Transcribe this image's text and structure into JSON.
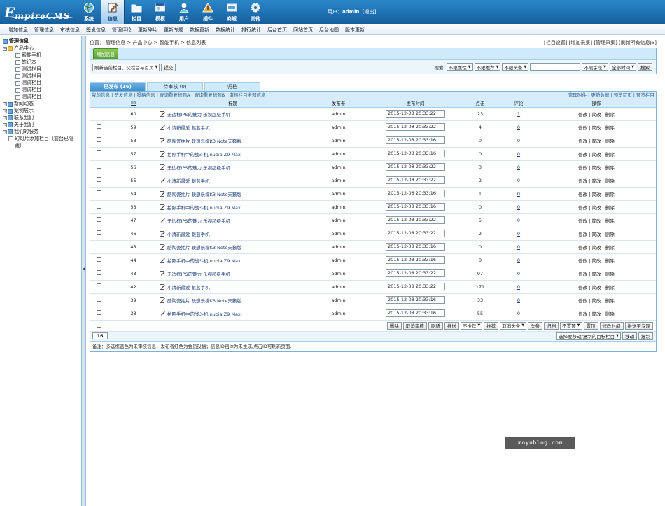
{
  "logo": {
    "e": "E",
    "rest": "mpireCMS"
  },
  "nav": [
    {
      "label": "系统",
      "icon": "globe-icon",
      "active": false
    },
    {
      "label": "信息",
      "icon": "pencil-icon",
      "active": true
    },
    {
      "label": "栏目",
      "icon": "folder-icon",
      "active": false
    },
    {
      "label": "模板",
      "icon": "window-icon",
      "active": false
    },
    {
      "label": "用户",
      "icon": "user-icon",
      "active": false
    },
    {
      "label": "插件",
      "icon": "triangle-icon",
      "active": false
    },
    {
      "label": "商城",
      "icon": "shop-icon",
      "active": false
    },
    {
      "label": "其他",
      "icon": "gear-icon",
      "active": false
    }
  ],
  "user": {
    "prefix": "用户：",
    "name": "admin",
    "logout": "[退出]"
  },
  "subnav": [
    "增加信息",
    "管理信息",
    "审核信息",
    "签发信息",
    "管理评论",
    "更新碎片",
    "更新专题",
    "数据更新",
    "数据统计",
    "排行统计",
    "后台首页",
    "网站首页",
    "后台地图",
    "版本更新"
  ],
  "tree": {
    "root": "管理信息",
    "items": [
      {
        "label": "产品中心",
        "level": 0,
        "type": "open"
      },
      {
        "label": "智能手机",
        "level": 2,
        "type": "doc"
      },
      {
        "label": "笔记本",
        "level": 2,
        "type": "doc"
      },
      {
        "label": "测试栏目",
        "level": 2,
        "type": "doc"
      },
      {
        "label": "测试栏目",
        "level": 2,
        "type": "doc"
      },
      {
        "label": "测试栏目",
        "level": 2,
        "type": "doc"
      },
      {
        "label": "测试栏目",
        "level": 2,
        "type": "doc"
      },
      {
        "label": "测试栏目",
        "level": 2,
        "type": "doc"
      },
      {
        "label": "新闻动态",
        "level": 0,
        "type": "closed"
      },
      {
        "label": "案例展示",
        "level": 0,
        "type": "closed"
      },
      {
        "label": "联系我们",
        "level": 0,
        "type": "closed"
      },
      {
        "label": "关于我们",
        "level": 0,
        "type": "closed"
      },
      {
        "label": "我们的服务",
        "level": 0,
        "type": "closed"
      },
      {
        "label": "幻灯片添加栏目（前台已隐",
        "level": 1,
        "type": "doc"
      },
      {
        "label": "藏）",
        "level": 1,
        "type": "cont"
      }
    ]
  },
  "position": {
    "text": "位置： 管理信息 > 产品中心 > 智能手机 > 信息列表",
    "right": "[栏目设置] [增加采集] [管理采集] [刷新所有信息JS]"
  },
  "toolbar": {
    "add_button": "增加信息",
    "refresh_select": "刷新当前栏目、父栏目与首页",
    "submit": "提交",
    "search_label": "搜索:",
    "filters": [
      "不限属性",
      "不限推荐",
      "不限头条"
    ],
    "field_select": "不限字段",
    "time_select": "全部时间",
    "search_button": "搜索"
  },
  "tabs": [
    {
      "label": "已发布 (16)",
      "active": true
    },
    {
      "label": "待审核 (0)",
      "active": false
    },
    {
      "label": "归档",
      "active": false
    }
  ],
  "linkrow": {
    "left": "我的信息 | 签发信息 | 投稿信息 | 查询重复标题A | 查询重复标题B | 审核栏目全部信息",
    "right": "管理附件 | 更新数据 | 预览首页 | 预览栏目"
  },
  "columns": [
    "ID",
    "标题",
    "发布者",
    "发布时间",
    "点击",
    "评论",
    "操作"
  ],
  "rows": [
    {
      "id": "60",
      "title": "无边框IPS的魅力 乐视超级手机",
      "author": "admin",
      "time": "2015-12-08 20:33:22",
      "clicks": "23",
      "comments": "1"
    },
    {
      "id": "59",
      "title": "小清新最爱 魅蓝手机",
      "author": "admin",
      "time": "2015-12-08 20:33:22",
      "clicks": "4",
      "comments": "0"
    },
    {
      "id": "58",
      "title": "酷陶瓷抽片 联想乐檬K3 Note天籁版",
      "author": "admin",
      "time": "2015-12-08 20:33:16",
      "clicks": "0",
      "comments": "0"
    },
    {
      "id": "57",
      "title": "拍照手机中的战斗机 nubia Z9 Max",
      "author": "admin",
      "time": "2015-12-08 20:33:16",
      "clicks": "0",
      "comments": "0"
    },
    {
      "id": "56",
      "title": "无边框IPS的魅力 乐视超级手机",
      "author": "admin",
      "time": "2015-12-08 20:33:22",
      "clicks": "3",
      "comments": "0"
    },
    {
      "id": "55",
      "title": "小清新最爱 魅蓝手机",
      "author": "admin",
      "time": "2015-12-08 20:33:22",
      "clicks": "2",
      "comments": "0"
    },
    {
      "id": "54",
      "title": "酷陶瓷抽片 联想乐檬K3 Note天籁版",
      "author": "admin",
      "time": "2015-12-08 20:33:16",
      "clicks": "1",
      "comments": "0"
    },
    {
      "id": "53",
      "title": "拍照手机中的战斗机 nubia Z9 Max",
      "author": "admin",
      "time": "2015-12-08 20:33:16",
      "clicks": "0",
      "comments": "0"
    },
    {
      "id": "47",
      "title": "无边框IPS的魅力 乐视超级手机",
      "author": "admin",
      "time": "2015-12-08 20:33:22",
      "clicks": "5",
      "comments": "0"
    },
    {
      "id": "46",
      "title": "小清新最爱 魅蓝手机",
      "author": "admin",
      "time": "2015-12-08 20:33:22",
      "clicks": "2",
      "comments": "0"
    },
    {
      "id": "45",
      "title": "酷陶瓷抽片 联想乐檬K3 Note天籁版",
      "author": "admin",
      "time": "2015-12-08 20:33:16",
      "clicks": "0",
      "comments": "0"
    },
    {
      "id": "44",
      "title": "拍照手机中的战斗机 nubia Z9 Max",
      "author": "admin",
      "time": "2015-12-08 20:33:16",
      "clicks": "0",
      "comments": "0"
    },
    {
      "id": "43",
      "title": "无边框IPS的魅力 乐视超级手机",
      "author": "admin",
      "time": "2015-12-08 20:33:22",
      "clicks": "97",
      "comments": "0"
    },
    {
      "id": "42",
      "title": "小清新最爱 魅蓝手机",
      "author": "admin",
      "time": "2015-12-08 20:33:22",
      "clicks": "171",
      "comments": "0"
    },
    {
      "id": "39",
      "title": "酷陶瓷抽片 联想乐檬K3 Note天籁版",
      "author": "admin",
      "time": "2015-12-08 20:33:16",
      "clicks": "33",
      "comments": "0"
    },
    {
      "id": "33",
      "title": "拍照手机中的战斗机 nubia Z9 Max",
      "author": "admin",
      "time": "2015-12-08 20:33:16",
      "clicks": "55",
      "comments": "0"
    }
  ],
  "ops": [
    "修改",
    "简改",
    "删除"
  ],
  "bottom_buttons": [
    {
      "type": "btn",
      "label": "删除"
    },
    {
      "type": "btn",
      "label": "取消审核"
    },
    {
      "type": "btn",
      "label": "刷新"
    },
    {
      "type": "btn",
      "label": "推送"
    },
    {
      "type": "sel",
      "label": "不推荐"
    },
    {
      "type": "btn",
      "label": "推荐"
    },
    {
      "type": "sel",
      "label": "取消头条"
    },
    {
      "type": "btn",
      "label": "头条"
    },
    {
      "type": "btn",
      "label": "归档"
    },
    {
      "type": "sel",
      "label": "不置顶"
    },
    {
      "type": "btn",
      "label": "置顶"
    },
    {
      "type": "btn",
      "label": "修改时间"
    },
    {
      "type": "btn",
      "label": "推送至专题"
    }
  ],
  "pager": {
    "count": "16",
    "move_select": "选择要移动/复制的目标栏目",
    "move": "移动",
    "copy": "复制"
  },
  "note": "备注：多选框蓝色为未审核信息；发布者红色为会员投稿；信息ID粗体为未生成,点击ID可刷新页面.",
  "watermark": "moyublog.com",
  "colors": {
    "header": "#1d6fb0",
    "tab_active": "#3f8fcb",
    "panel": "#cfeafa",
    "green": "#5aa02e"
  }
}
